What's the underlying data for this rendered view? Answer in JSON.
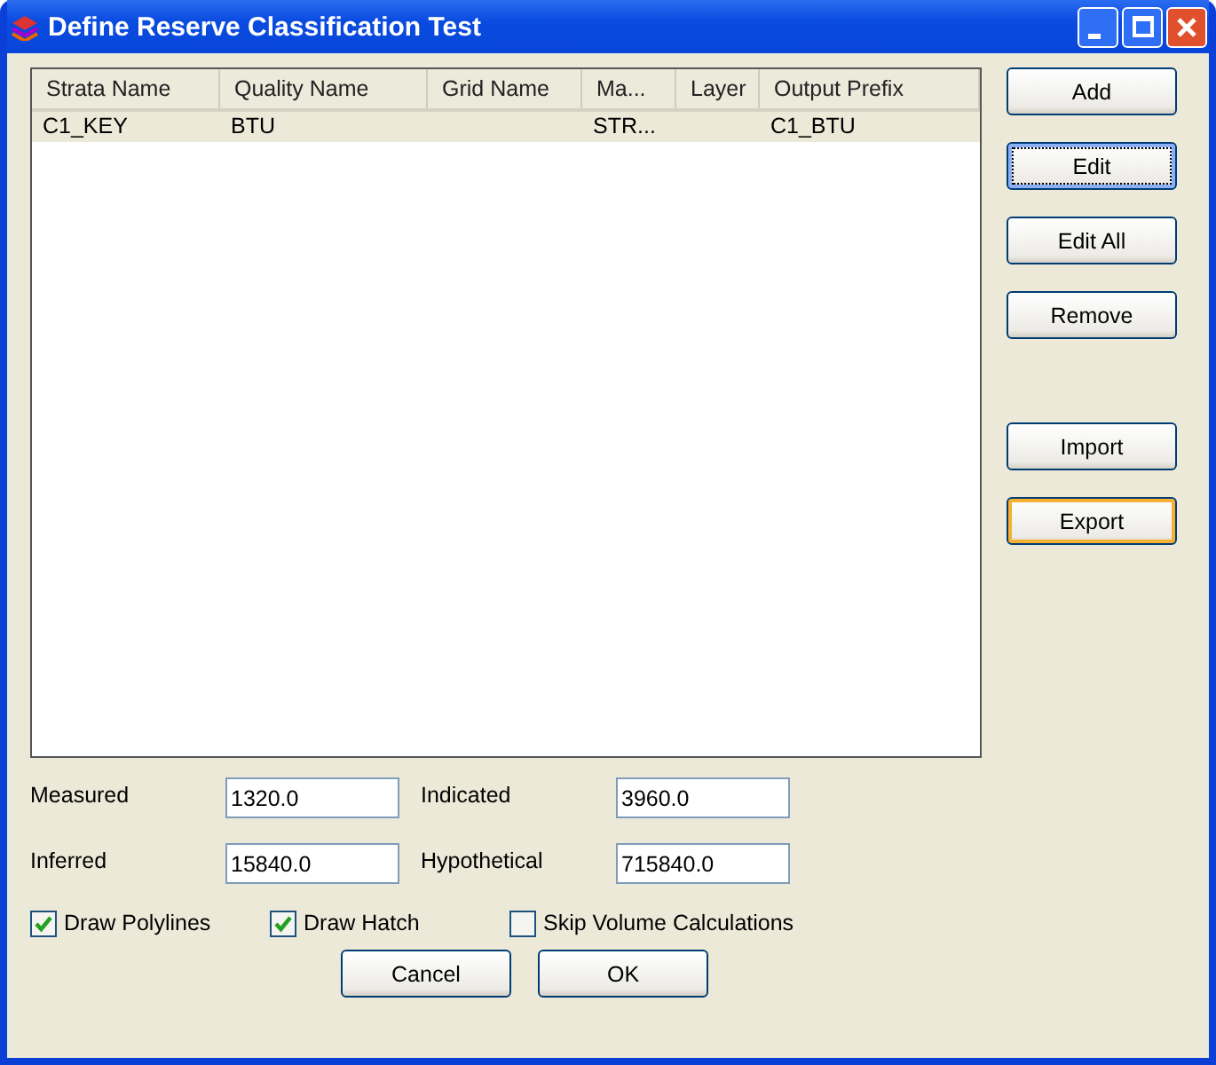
{
  "window": {
    "title": "Define Reserve Classification Test"
  },
  "table": {
    "columns": [
      "Strata Name",
      "Quality Name",
      "Grid Name",
      "Ma...",
      "Layer",
      "Output Prefix"
    ],
    "rows": [
      {
        "selected": true,
        "cells": [
          "C1_KEY",
          "BTU",
          "",
          "STR...",
          "",
          "C1_BTU"
        ]
      }
    ]
  },
  "side_buttons": [
    {
      "label": "Add",
      "focused": false,
      "hot": false
    },
    {
      "label": "Edit",
      "focused": true,
      "hot": false
    },
    {
      "label": "Edit All",
      "focused": false,
      "hot": false
    },
    {
      "label": "Remove",
      "focused": false,
      "hot": false
    },
    {
      "label": "Import",
      "focused": false,
      "hot": false
    },
    {
      "label": "Export",
      "focused": false,
      "hot": true
    }
  ],
  "fields": [
    {
      "label": "Measured",
      "value": "1320.0"
    },
    {
      "label": "Indicated",
      "value": "3960.0"
    },
    {
      "label": "Inferred",
      "value": "15840.0"
    },
    {
      "label": "Hypothetical",
      "value": "715840.0"
    }
  ],
  "checkboxes": [
    {
      "label": "Draw Polylines",
      "checked": true
    },
    {
      "label": "Draw Hatch",
      "checked": true
    },
    {
      "label": "Skip Volume Calculations",
      "checked": false
    }
  ],
  "buttons": [
    "Cancel",
    "OK"
  ]
}
